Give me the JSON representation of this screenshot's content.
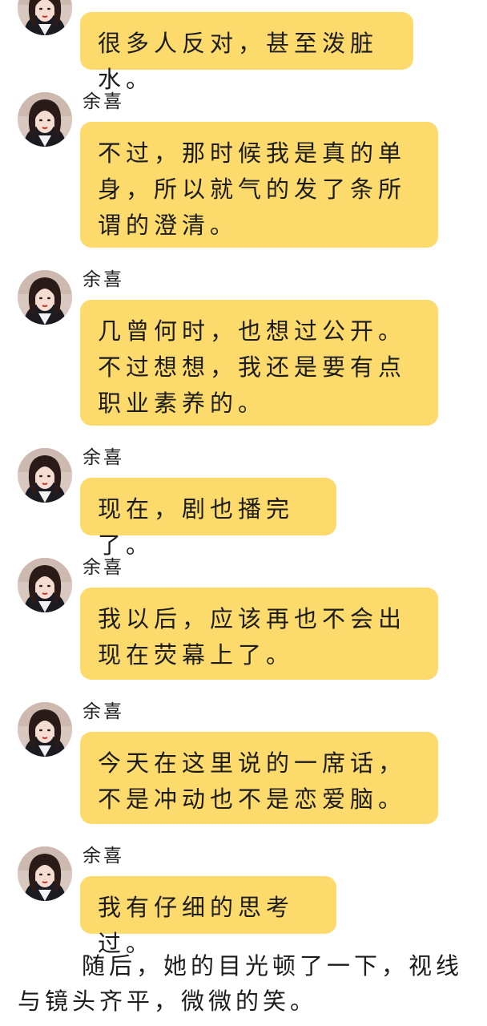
{
  "messages": [
    {
      "name": "",
      "text": "很多人反对，甚至泼脏水。"
    },
    {
      "name": "余喜",
      "text": "不过，那时候我是真的单身，所以就气的发了条所谓的澄清。"
    },
    {
      "name": "余喜",
      "text": "几曾何时，也想过公开。不过想想，我还是要有点职业素养的。"
    },
    {
      "name": "余喜",
      "text": "现在，剧也播完了。"
    },
    {
      "name": "余喜",
      "text": "我以后，应该再也不会出现在荧幕上了。"
    },
    {
      "name": "余喜",
      "text": "今天在这里说的一席话，不是冲动也不是恋爱脑。"
    },
    {
      "name": "余喜",
      "text": "我有仔细的思考过。"
    }
  ],
  "narration": "随后，她的目光顿了一下，视线与镜头齐平，微微的笑。",
  "colors": {
    "bubble": "#fcda6b",
    "background": "#ffffff",
    "text": "#1c1c1c"
  },
  "icons": {
    "avatar": "avatar-portrait-icon"
  }
}
